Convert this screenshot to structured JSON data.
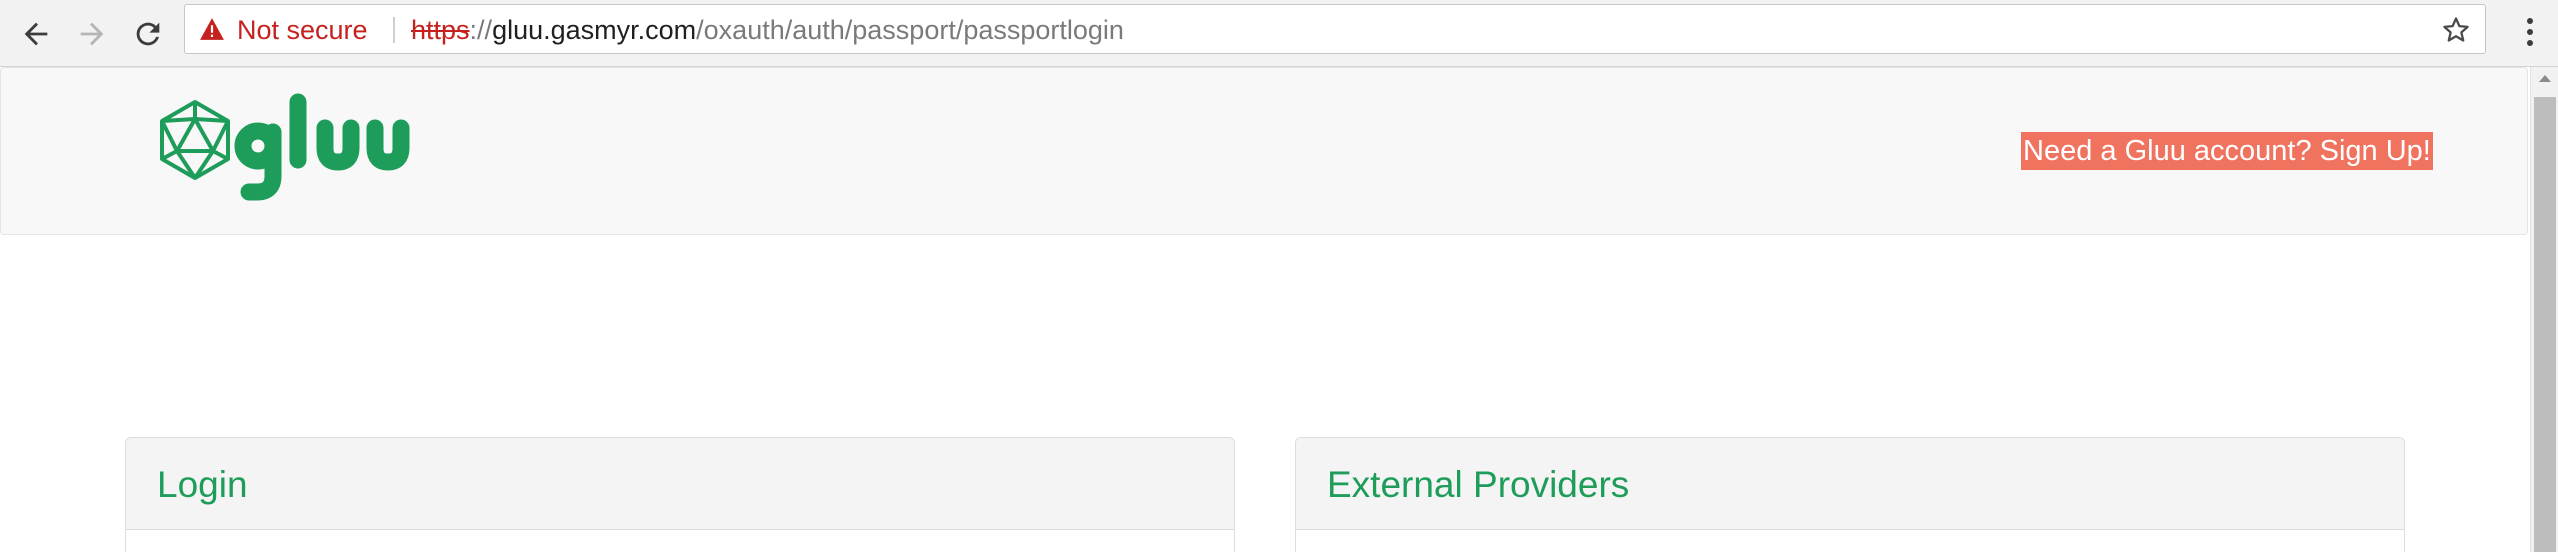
{
  "browser": {
    "security_label": "Not secure",
    "url": {
      "scheme": "https",
      "separator": "://",
      "host": "gluu.gasmyr.com",
      "path": "/oxauth/auth/passport/passportlogin"
    },
    "icons": [
      "back-arrow-icon",
      "forward-arrow-icon",
      "reload-icon",
      "warning-triangle-icon",
      "bookmark-star-icon",
      "kebab-menu-icon"
    ]
  },
  "header": {
    "logo_text": "gluu",
    "signup_link": "Need a Gluu account? Sign Up!"
  },
  "panels": {
    "login": {
      "title": "Login"
    },
    "external": {
      "title": "External Providers"
    }
  },
  "colors": {
    "brand_green": "#1e9c5a",
    "signup_bg": "#f0735f",
    "insecure_red": "#c5221f"
  }
}
